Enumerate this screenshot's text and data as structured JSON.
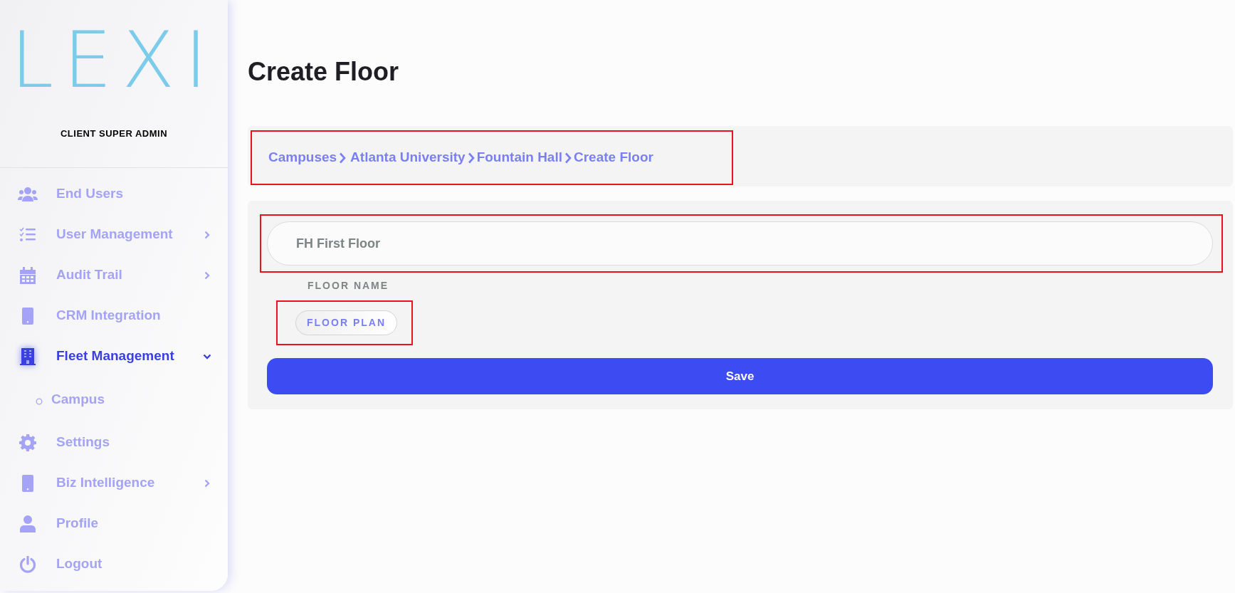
{
  "sidebar": {
    "logo": "LEXI",
    "role": "CLIENT SUPER ADMIN",
    "items": [
      {
        "label": "End Users",
        "selected": false
      },
      {
        "label": "User Management",
        "selected": false,
        "expanded": false
      },
      {
        "label": "Audit Trail",
        "selected": false,
        "expanded": false
      },
      {
        "label": "CRM Integration",
        "selected": false
      },
      {
        "label": "Fleet Management",
        "selected": true,
        "expanded": true,
        "children": [
          {
            "label": "Campus",
            "selected": false
          }
        ]
      },
      {
        "label": "Settings",
        "selected": false
      },
      {
        "label": "Biz Intelligence",
        "selected": false,
        "expanded": false
      },
      {
        "label": "Profile",
        "selected": false
      },
      {
        "label": "Logout",
        "selected": false
      }
    ]
  },
  "page_title": "Create Floor",
  "breadcrumb": {
    "highlighted": true,
    "items": [
      "Campuses",
      "Atlanta University",
      "Fountain Hall",
      "Create Floor"
    ]
  },
  "form": {
    "floor_name": {
      "value": "FH First Floor",
      "label": "FLOOR NAME",
      "highlighted": true
    },
    "floor_plan_button": {
      "label": "FLOOR PLAN",
      "highlighted": true
    },
    "save_button": "Save"
  }
}
